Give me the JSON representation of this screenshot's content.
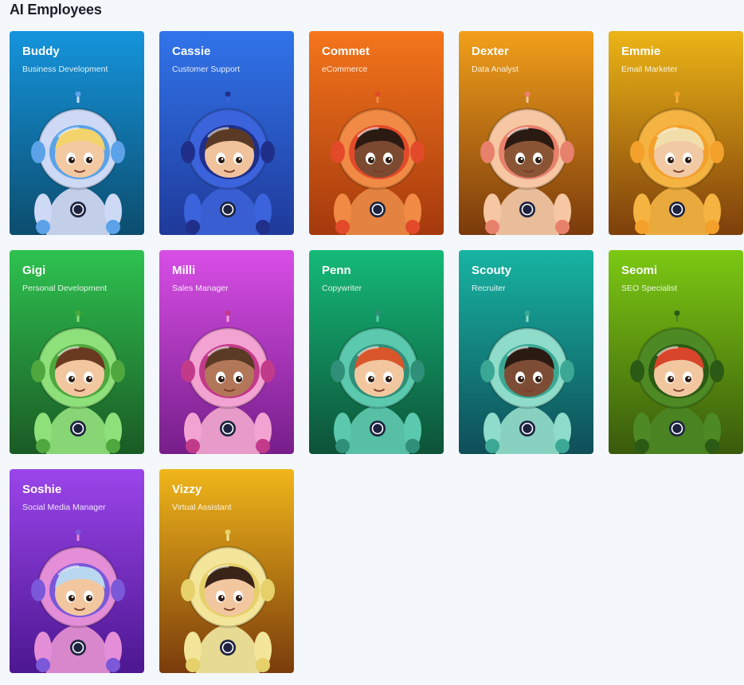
{
  "page": {
    "title": "AI Employees"
  },
  "employees": [
    {
      "name": "Buddy",
      "role": "Business Development",
      "top": "#1594dc",
      "bottom": "#0c4d6e",
      "suit": "#cdd9f5",
      "visor": "#5ba2e8",
      "hair": "#f3d36b",
      "skin": "#f3c9a1"
    },
    {
      "name": "Cassie",
      "role": "Customer Support",
      "top": "#3174ea",
      "bottom": "#1f3a9a",
      "suit": "#3b63dc",
      "visor": "#1f2f8a",
      "hair": "#5a3a24",
      "skin": "#f0c39d"
    },
    {
      "name": "Commet",
      "role": "eCommerce",
      "top": "#f4761c",
      "bottom": "#a5390d",
      "suit": "#f08a44",
      "visor": "#e24a2a",
      "hair": "#2b1a12",
      "skin": "#7b4a30"
    },
    {
      "name": "Dexter",
      "role": "Data Analyst",
      "top": "#f2a01a",
      "bottom": "#7a3a0c",
      "suit": "#f6c7a2",
      "visor": "#e8816c",
      "hair": "#2a1a12",
      "skin": "#8a5535"
    },
    {
      "name": "Emmie",
      "role": "Email Marketer",
      "top": "#ecb516",
      "bottom": "#7d3f0c",
      "suit": "#f5b341",
      "visor": "#f3a12a",
      "hair": "#f2deaa",
      "skin": "#f1c9a4"
    },
    {
      "name": "Gigi",
      "role": "Personal Development",
      "top": "#2ec250",
      "bottom": "#1a5a24",
      "suit": "#8ee07a",
      "visor": "#4ea83e",
      "hair": "#6a3a20",
      "skin": "#f2c7a0"
    },
    {
      "name": "Milli",
      "role": "Sales Manager",
      "top": "#d84ee6",
      "bottom": "#761e8a",
      "suit": "#f3a3d2",
      "visor": "#c23a8a",
      "hair": "#5a3a24",
      "skin": "#b27658"
    },
    {
      "name": "Penn",
      "role": "Copywriter",
      "top": "#15ba78",
      "bottom": "#0d5238",
      "suit": "#5bc9ad",
      "visor": "#2f8f78",
      "hair": "#d8562a",
      "skin": "#f2c7a0"
    },
    {
      "name": "Scouty",
      "role": "Recruiter",
      "top": "#17b4a2",
      "bottom": "#0f4e58",
      "suit": "#8fdccb",
      "visor": "#3aa894",
      "hair": "#2a1a12",
      "skin": "#7d4c34"
    },
    {
      "name": "Seomi",
      "role": "SEO Specialist",
      "top": "#7cc913",
      "bottom": "#3a5a0c",
      "suit": "#4e8a24",
      "visor": "#2b5a14",
      "hair": "#d8452a",
      "skin": "#f2c7a0"
    },
    {
      "name": "Soshie",
      "role": "Social Media Manager",
      "top": "#9b45ea",
      "bottom": "#4c1790",
      "suit": "#e48ed8",
      "visor": "#7a58d8",
      "hair": "#b9d8f0",
      "skin": "#f2c7a0"
    },
    {
      "name": "Vizzy",
      "role": "Virtual Assistant",
      "top": "#f0b61a",
      "bottom": "#7a3c0c",
      "suit": "#f3e59a",
      "visor": "#e6d06a",
      "hair": "#3a2418",
      "skin": "#f2c7a0"
    }
  ]
}
